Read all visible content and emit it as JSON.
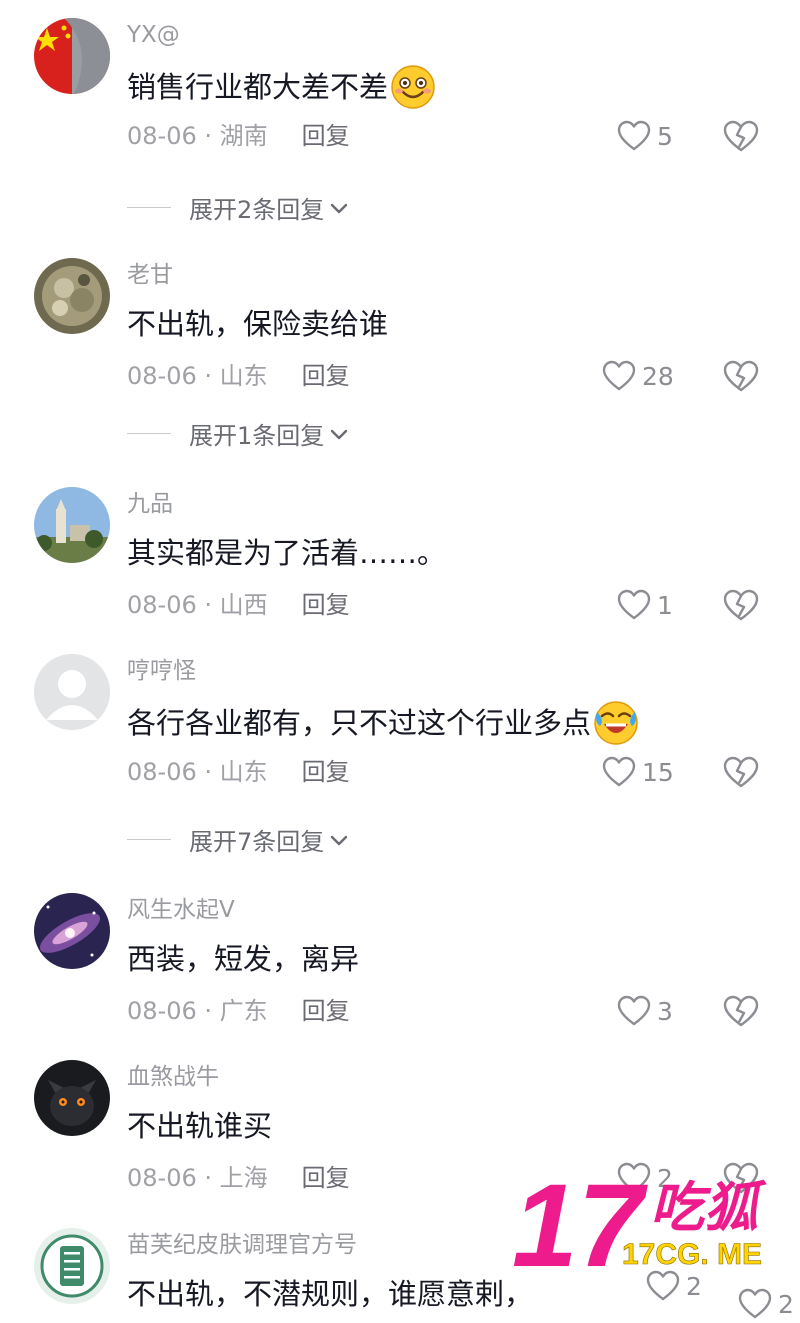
{
  "comments": [
    {
      "username": "YX@",
      "text": "销售行业都大差不差",
      "date": "08-06",
      "location": "湖南",
      "reply_label": "回复",
      "likes": "5",
      "emoji": "smile-emoji",
      "expand": "展开2条回复"
    },
    {
      "username": "老甘",
      "text": "不出轨，保险卖给谁",
      "date": "08-06",
      "location": "山东",
      "reply_label": "回复",
      "likes": "28",
      "expand": "展开1条回复"
    },
    {
      "username": "九品",
      "text": "其实都是为了活着……。",
      "date": "08-06",
      "location": "山西",
      "reply_label": "回复",
      "likes": "1"
    },
    {
      "username": "哼哼怪",
      "text": "各行各业都有，只不过这个行业多点",
      "date": "08-06",
      "location": "山东",
      "reply_label": "回复",
      "likes": "15",
      "emoji": "laugh-cry-emoji",
      "expand": "展开7条回复"
    },
    {
      "username": "风生水起V",
      "text": "西装，短发，离异",
      "date": "08-06",
      "location": "广东",
      "reply_label": "回复",
      "likes": "3"
    },
    {
      "username": "血煞战牛",
      "text": "不出轨谁买",
      "date": "08-06",
      "location": "上海",
      "reply_label": "回复",
      "likes": "2"
    },
    {
      "username": "苗芙纪皮肤调理官方号",
      "text": "不出轨，不潜规则，谁愿意剌，",
      "likes": "2",
      "likes_extra": "2"
    }
  ],
  "watermark": {
    "big": "17",
    "cn": "吃狐",
    "url": "17CG. ME"
  },
  "colors": {
    "text": "#161823",
    "muted": "#a0a1a6",
    "watermark": "#ee1b8c"
  }
}
